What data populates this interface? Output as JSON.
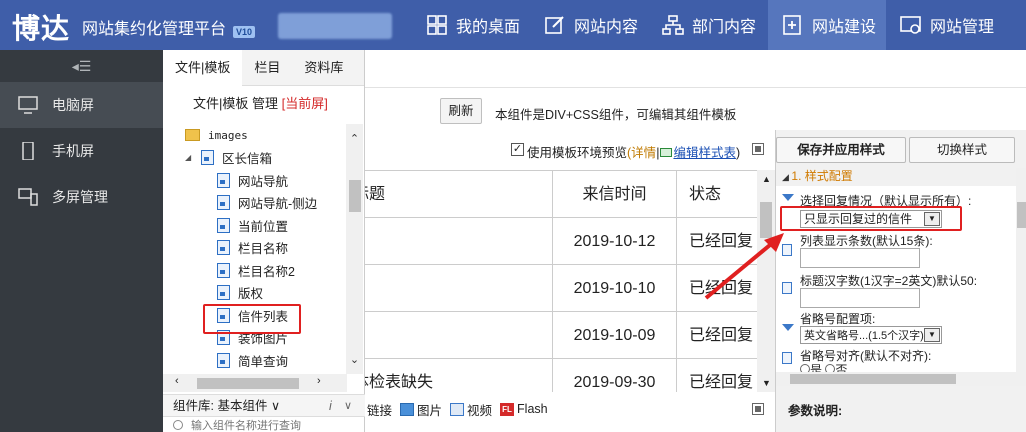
{
  "header": {
    "logo": "博达",
    "app_title": "网站集约化管理平台",
    "version": "V10",
    "nav": [
      {
        "label": "我的桌面",
        "icon": "desktop-icon"
      },
      {
        "label": "网站内容",
        "icon": "edit-icon"
      },
      {
        "label": "部门内容",
        "icon": "org-icon"
      },
      {
        "label": "网站建设",
        "icon": "add-page-icon",
        "active": true
      },
      {
        "label": "网站管理",
        "icon": "site-settings-icon"
      }
    ]
  },
  "sidebar": {
    "items": [
      {
        "label": "电脑屏",
        "icon": "monitor-icon",
        "active": true
      },
      {
        "label": "手机屏",
        "icon": "phone-icon"
      },
      {
        "label": "多屏管理",
        "icon": "multi-screen-icon"
      }
    ]
  },
  "tree": {
    "tabs": [
      "文件|模板",
      "栏目",
      "资料库"
    ],
    "subtitle": "文件|模板 管理",
    "subtitle_current": "[当前屏]",
    "rows": [
      {
        "label": "images",
        "type": "folder",
        "indent": 1
      },
      {
        "label": "区长信箱",
        "type": "folder-open",
        "indent": 0
      },
      {
        "label": "网站导航",
        "type": "file",
        "indent": 2
      },
      {
        "label": "网站导航-侧边",
        "type": "file",
        "indent": 2
      },
      {
        "label": "当前位置",
        "type": "file",
        "indent": 2
      },
      {
        "label": "栏目名称",
        "type": "file",
        "indent": 2
      },
      {
        "label": "栏目名称2",
        "type": "file",
        "indent": 2
      },
      {
        "label": "版权",
        "type": "file",
        "indent": 2
      },
      {
        "label": "信件列表",
        "type": "file",
        "indent": 2,
        "highlight": true
      },
      {
        "label": "装饰图片",
        "type": "file",
        "indent": 2
      },
      {
        "label": "简单查询",
        "type": "file",
        "indent": 2
      }
    ],
    "component_lib_label": "组件库: 基本组件",
    "component_search_placeholder": "输入组件名称进行查询"
  },
  "toolbar": {
    "refresh_label": "刷新",
    "notice": "本组件是DIV+CSS组件，可编辑其组件模板",
    "preview_label": "使用模板环境预览",
    "detail_link": "(详情",
    "separator": "|",
    "edit_style_link": "编辑样式表",
    "close_paren": ")"
  },
  "table": {
    "headers": [
      "标题",
      "来信时间",
      "状态"
    ],
    "rows": [
      {
        "title": "",
        "date": "2019-10-12",
        "status": "已经回复"
      },
      {
        "title": "",
        "date": "2019-10-10",
        "status": "已经回复"
      },
      {
        "title": "",
        "date": "2019-10-09",
        "status": "已经回复"
      },
      {
        "title": "体检表缺失",
        "date": "2019-09-30",
        "status": "已经回复"
      }
    ]
  },
  "components_bar": {
    "items": [
      {
        "label": "链接",
        "icon": "link-icon"
      },
      {
        "label": "图片",
        "icon": "image-icon"
      },
      {
        "label": "视频",
        "icon": "video-icon"
      },
      {
        "label": "Flash",
        "icon": "flash-icon"
      }
    ]
  },
  "style_panel": {
    "save_label": "保存并应用样式",
    "switch_label": "切换样式",
    "section_title": "1. 样式配置",
    "fields": {
      "reply_filter_label": "选择回复情况（默认显示所有）:",
      "reply_filter_value": "只显示回复过的信件",
      "list_count_label": "列表显示条数(默认15条):",
      "list_count_value": "",
      "title_chars_label": "标题汉字数(1汉字=2英文)默认50:",
      "title_chars_value": "",
      "ellipsis_label": "省略号配置项:",
      "ellipsis_value": "英文省略号...(1.5个汉字)",
      "ellipsis_align_label": "省略号对齐(默认不对齐):",
      "radio_yes": "是",
      "radio_no": "否"
    },
    "param_title": "参数说明:"
  },
  "colors": {
    "header_bg": "#3f5ea9",
    "sidebar_bg": "#353a40",
    "highlight_red": "#e02020",
    "section_orange": "#d07a00"
  }
}
